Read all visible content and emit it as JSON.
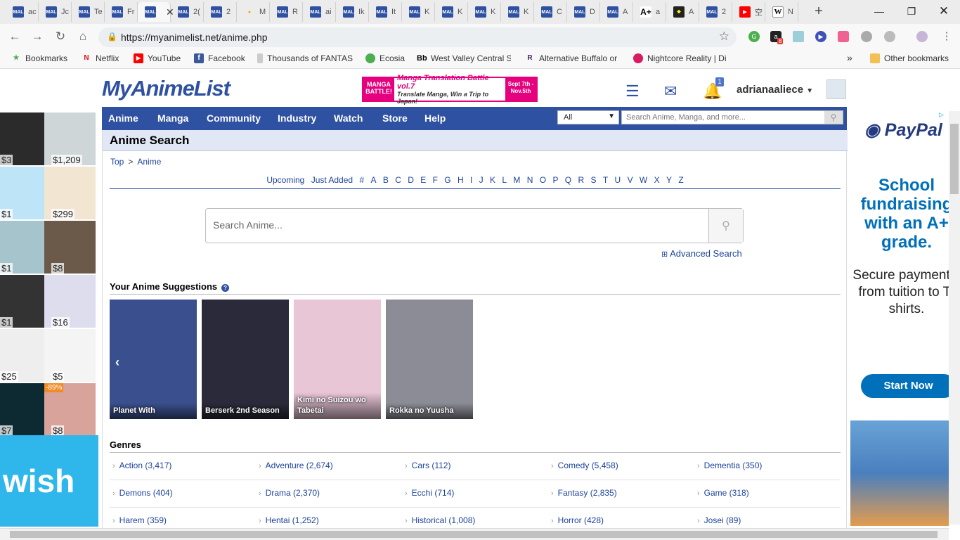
{
  "browser": {
    "tabs": [
      {
        "icon": "mal",
        "label": "ac"
      },
      {
        "icon": "mal",
        "label": "Jc"
      },
      {
        "icon": "mal",
        "label": "Te"
      },
      {
        "icon": "mal",
        "label": "Fr"
      },
      {
        "icon": "mal",
        "label": "",
        "active": true
      },
      {
        "icon": "mal",
        "label": "2("
      },
      {
        "icon": "mal",
        "label": "2"
      },
      {
        "icon": "gen",
        "label": "M"
      },
      {
        "icon": "mal",
        "label": "R"
      },
      {
        "icon": "mal",
        "label": "ai"
      },
      {
        "icon": "mal",
        "label": "Ik"
      },
      {
        "icon": "mal",
        "label": "It"
      },
      {
        "icon": "mal",
        "label": "K"
      },
      {
        "icon": "mal",
        "label": "K"
      },
      {
        "icon": "mal",
        "label": "K"
      },
      {
        "icon": "mal",
        "label": "K"
      },
      {
        "icon": "mal",
        "label": "C"
      },
      {
        "icon": "mal",
        "label": "D"
      },
      {
        "icon": "mal",
        "label": "A"
      },
      {
        "icon": "ap",
        "label": "a"
      },
      {
        "icon": "dark",
        "label": "A"
      },
      {
        "icon": "mal",
        "label": "2"
      },
      {
        "icon": "yt",
        "label": "空"
      },
      {
        "icon": "wk",
        "label": "N"
      }
    ],
    "new_tab_label": "+",
    "url": "https://myanimelist.net/anime.php",
    "extension_badge": "8",
    "bookmarks": [
      {
        "label": "Bookmarks"
      },
      {
        "label": "Netflix"
      },
      {
        "label": "YouTube"
      },
      {
        "label": "Facebook"
      },
      {
        "label": "Thousands of FANTAS"
      },
      {
        "label": "Ecosia"
      },
      {
        "label": "West Valley Central S"
      },
      {
        "label": "Alternative Buffalo or"
      },
      {
        "label": "Nightcore Reality | Di"
      }
    ],
    "more_bookmarks": "»",
    "other_bookmarks": "Other bookmarks"
  },
  "site": {
    "logo": "MyAnimeList",
    "banner": {
      "left": "MANGA BATTLE!",
      "title": "Manga Translation Battle vol.7",
      "subtitle": "Translate Manga, Win a Trip to Japan!",
      "dates": "Sept 7th - Nov.5th"
    },
    "notification_count": "1",
    "username": "adrianaaliece",
    "nav": [
      "Anime",
      "Manga",
      "Community",
      "Industry",
      "Watch",
      "Store",
      "Help"
    ],
    "search_select": "All",
    "search_placeholder": "Search Anime, Manga, and more..."
  },
  "page": {
    "title": "Anime Search",
    "breadcrumb": [
      "Top",
      "Anime"
    ],
    "breadcrumb_sep": ">",
    "alpha_links": [
      "Upcoming",
      "Just Added",
      "#",
      "A",
      "B",
      "C",
      "D",
      "E",
      "F",
      "G",
      "H",
      "I",
      "J",
      "K",
      "L",
      "M",
      "N",
      "O",
      "P",
      "Q",
      "R",
      "S",
      "T",
      "U",
      "V",
      "W",
      "X",
      "Y",
      "Z"
    ],
    "search_placeholder": "Search Anime...",
    "advanced_search": "Advanced Search",
    "suggestions_title": "Your Anime Suggestions",
    "suggestions_help": "?",
    "suggestions": [
      {
        "title": "Planet With",
        "color": "#3a4f8e"
      },
      {
        "title": "Berserk 2nd Season",
        "color": "#2a2a3a"
      },
      {
        "title": "Kimi no Suizou wo Tabetai",
        "color": "#e8c6d6"
      },
      {
        "title": "Rokka no Yuusha",
        "color": "#8c8c96"
      }
    ],
    "genres_title": "Genres",
    "genres": [
      [
        "Action (3,417)",
        "Adventure (2,674)",
        "Cars (112)",
        "Comedy (5,458)",
        "Dementia (350)"
      ],
      [
        "Demons (404)",
        "Drama (2,370)",
        "Ecchi (714)",
        "Fantasy (2,835)",
        "Game (318)"
      ],
      [
        "Harem (359)",
        "Hentai (1,252)",
        "Historical (1,008)",
        "Horror (428)",
        "Josei (89)"
      ]
    ]
  },
  "left_ad": {
    "prices": [
      "$3",
      "$1,209",
      "$1",
      "$299",
      "$1",
      "$8",
      "$1",
      "$16",
      "$25",
      "$5",
      "$7",
      "$8"
    ],
    "discount_badges": [
      "-89%"
    ],
    "brand": "wish"
  },
  "right_ad": {
    "brand": "PayPal",
    "headline": "School fundraising with an A+ grade.",
    "body": "Secure payments, from tuition to T-shirts.",
    "cta": "Start Now"
  }
}
